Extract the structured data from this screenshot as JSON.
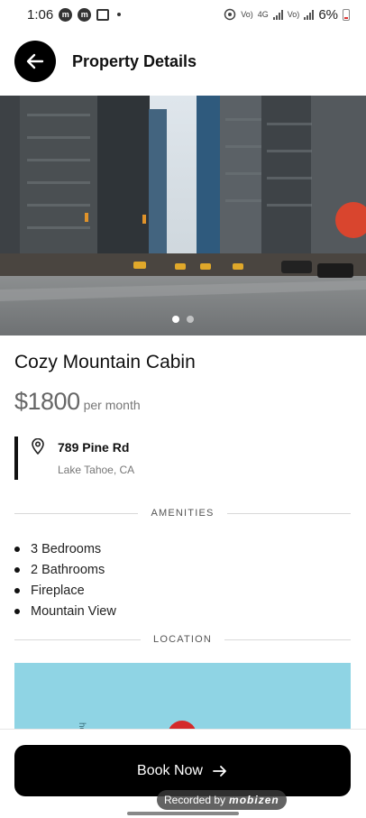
{
  "status_bar": {
    "time": "1:06",
    "battery": "6%",
    "network_labels": [
      "Vo)",
      "4G",
      "Vo)"
    ]
  },
  "header": {
    "title": "Property Details",
    "back_icon": "arrow-left-icon"
  },
  "hero": {
    "image_description_icon": "city-street-photo",
    "carousel_total": 2,
    "carousel_active": 1
  },
  "property": {
    "name": "Cozy Mountain Cabin",
    "price": "$1800",
    "price_period": "per month",
    "address_street": "789 Pine Rd",
    "address_city": "Lake Tahoe, CA"
  },
  "sections": {
    "amenities_label": "AMENITIES",
    "location_label": "LOCATION"
  },
  "amenities": [
    "3 Bedrooms",
    "2 Bathrooms",
    "Fireplace",
    "Mountain View"
  ],
  "map": {
    "label": "hoe"
  },
  "actions": {
    "book_label": "Book Now",
    "book_icon": "arrow-right-icon"
  },
  "overlay": {
    "recorded_by": "Recorded by",
    "recorder_brand": "mobizen"
  },
  "colors": {
    "primary": "#000000",
    "map_water": "#8fd4e4",
    "pin": "#d42a2a",
    "price_text": "#666666"
  }
}
